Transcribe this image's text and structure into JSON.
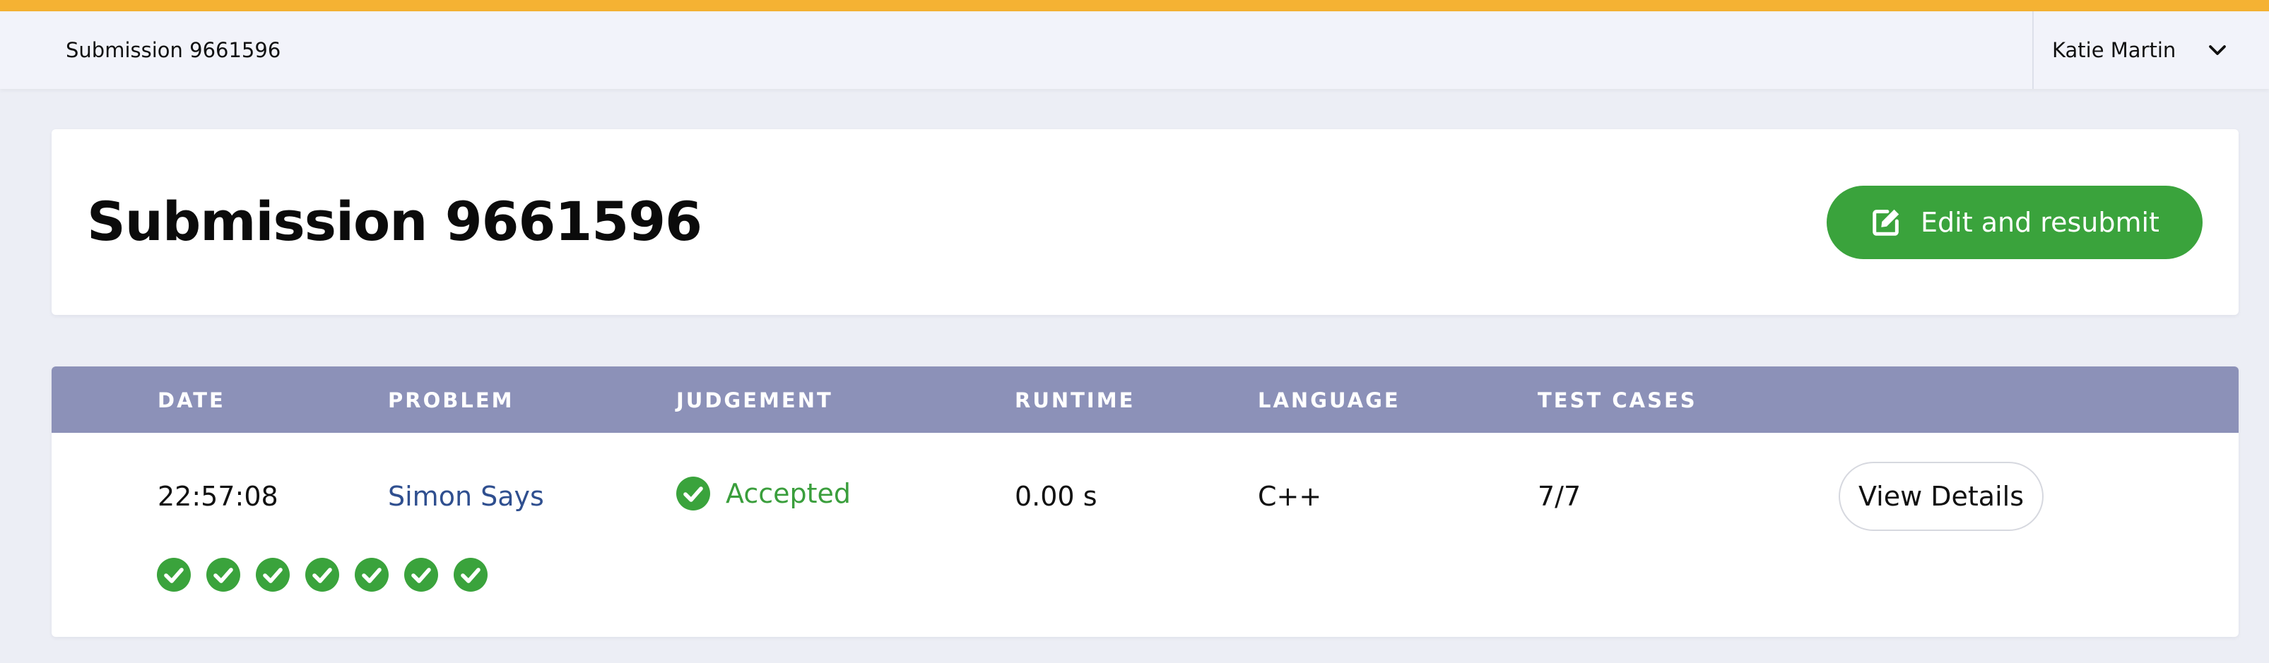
{
  "header": {
    "breadcrumb": "Submission 9661596",
    "user_name": "Katie Martin",
    "accent_color": "#f5b233"
  },
  "title_card": {
    "title": "Submission 9661596",
    "resubmit_label": "Edit and resubmit",
    "resubmit_icon": "edit-icon",
    "button_color": "#3aa33c"
  },
  "table": {
    "columns": [
      "DATE",
      "PROBLEM",
      "JUDGEMENT",
      "RUNTIME",
      "LANGUAGE",
      "TEST CASES"
    ],
    "header_color": "#8c91b8",
    "row": {
      "date": "22:57:08",
      "problem": "Simon Says",
      "judgement": "Accepted",
      "runtime": "0.00 s",
      "language": "C++",
      "test_cases": "7/7",
      "details_label": "View Details",
      "test_results": [
        "passed",
        "passed",
        "passed",
        "passed",
        "passed",
        "passed",
        "passed"
      ]
    },
    "status_color": "#3aa33c"
  }
}
